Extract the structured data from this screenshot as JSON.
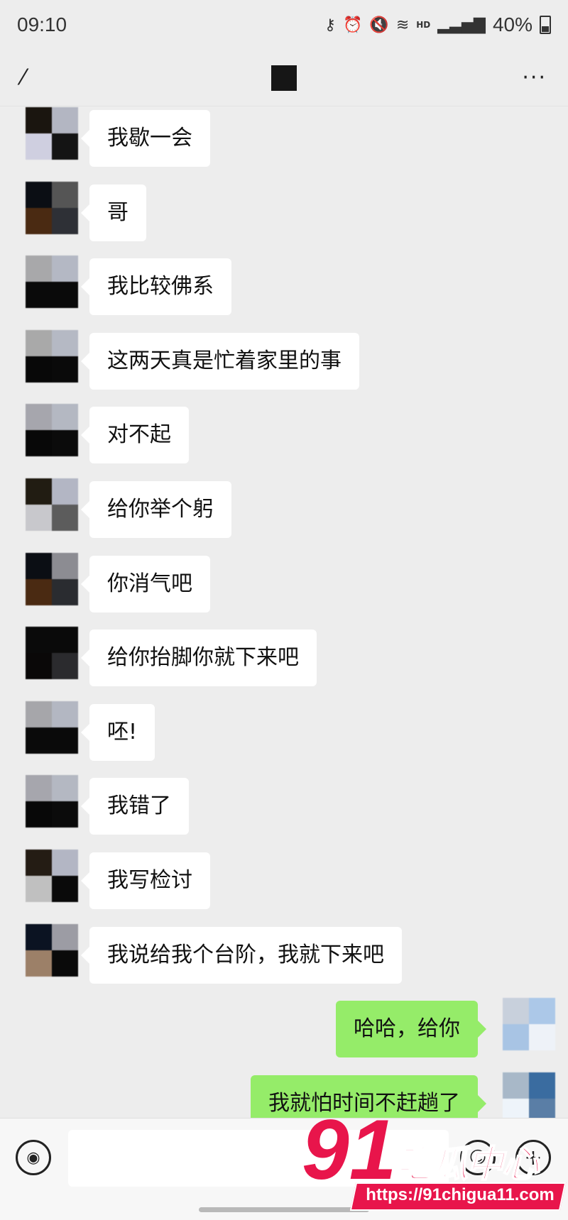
{
  "status_bar": {
    "time": "09:10",
    "icons": [
      "key-icon",
      "alarm-icon",
      "mute-icon",
      "wifi-icon",
      "hd-icon",
      "signal-icon"
    ],
    "hd_label": "HD",
    "battery": "40%"
  },
  "nav": {
    "back_icon": "back-icon",
    "more_icon": "more-icon",
    "title_redacted": true
  },
  "messages": [
    {
      "side": "left",
      "text": "我歇一会",
      "avatar": [
        "#1a150f",
        "#b3b6c2",
        "#cfcfe0",
        "#141414"
      ]
    },
    {
      "side": "left",
      "text": "哥",
      "avatar": [
        "#0b0e14",
        "#555555",
        "#4a2a12",
        "#2e3036"
      ]
    },
    {
      "side": "left",
      "text": "我比较佛系",
      "avatar": [
        "#a8a8aa",
        "#b4b8c4",
        "#0a0a0a",
        "#0a0a0a"
      ]
    },
    {
      "side": "left",
      "text": "这两天真是忙着家里的事",
      "avatar": [
        "#a9a9a9",
        "#b5b9c4",
        "#080808",
        "#0a0a0a"
      ]
    },
    {
      "side": "left",
      "text": "对不起",
      "avatar": [
        "#a6a6ad",
        "#b4b8c2",
        "#080808",
        "#0b0b0b"
      ]
    },
    {
      "side": "left",
      "text": "给你举个躬",
      "avatar": [
        "#211c12",
        "#b3b6c4",
        "#c8c8cc",
        "#5c5c5c"
      ]
    },
    {
      "side": "left",
      "text": "你消气吧",
      "avatar": [
        "#0b0e14",
        "#8c8c92",
        "#4a2a12",
        "#2a2c30"
      ]
    },
    {
      "side": "left",
      "text": "给你抬脚你就下来吧",
      "avatar": [
        "#0a0a0a",
        "#0a0a0a",
        "#0a0808",
        "#2b2b2e"
      ]
    },
    {
      "side": "left",
      "text": "呸!",
      "avatar": [
        "#a6a6aa",
        "#b3b7c2",
        "#0a0a0a",
        "#0a0a0a"
      ]
    },
    {
      "side": "left",
      "text": "我错了",
      "avatar": [
        "#a6a6ad",
        "#b4b8c2",
        "#080808",
        "#0b0b0b"
      ]
    },
    {
      "side": "left",
      "text": "我写检讨",
      "avatar": [
        "#241c14",
        "#b3b6c4",
        "#c0c0c0",
        "#0a0a0a"
      ]
    },
    {
      "side": "left",
      "text": "我说给我个台阶，我就下来吧",
      "avatar": [
        "#0b1322",
        "#9c9ca4",
        "#9c8068",
        "#0a0a0a"
      ]
    },
    {
      "side": "right",
      "text": "哈哈，给你",
      "avatar": [
        "#c8d0dc",
        "#acc8e8",
        "#a8c4e4",
        "#eef2f8"
      ]
    },
    {
      "side": "right",
      "text": "我就怕时间不赶趟了",
      "avatar": [
        "#a8b8c8",
        "#3a6ca0",
        "#eef4fa",
        "#5a7ea6"
      ]
    }
  ],
  "input_bar": {
    "placeholder": "",
    "voice_icon": "voice-icon",
    "emoji_icon": "emoji-icon",
    "plus_icon": "plus-icon"
  },
  "watermark": {
    "number": "91",
    "name": "吃瓜中心",
    "url": "https://91chigua11.com"
  }
}
